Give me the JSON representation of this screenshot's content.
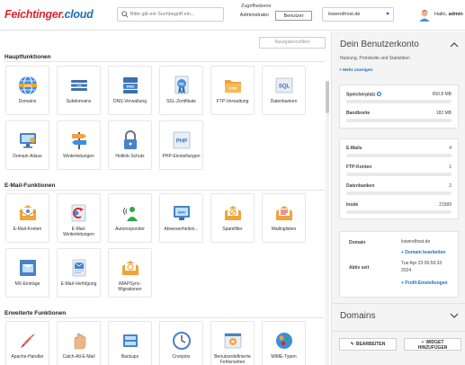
{
  "header": {
    "logo": {
      "part1": "Feichtinger",
      "dot": ".",
      "part2": "cloud"
    },
    "search_placeholder": "Bitte gib ein Suchbegriff ein...",
    "access_label": "Zugriffsebene",
    "access_admin": "Administrator",
    "access_user": "Benutzer",
    "domain": "lowendhost.de",
    "greeting": "Hallo,",
    "username": "admin"
  },
  "nav_filter": "Navigationsfilter",
  "sections": [
    {
      "title": "Hauptfunktionen",
      "tiles": [
        {
          "label": "Domains",
          "icon": "globe-icon"
        },
        {
          "label": "Subdomains",
          "icon": "subdomain-icon"
        },
        {
          "label": "DNS-Verwaltung",
          "icon": "dns-icon"
        },
        {
          "label": "SSL-Zertifikate",
          "icon": "ssl-certificate-icon"
        },
        {
          "label": "FTP-Verwaltung",
          "icon": "ftp-icon"
        },
        {
          "label": "Datenbanken",
          "icon": "sql-database-icon"
        },
        {
          "label": "Domain-Aliase",
          "icon": "monitor-icon"
        },
        {
          "label": "Weiterleitungen",
          "icon": "signpost-icon"
        },
        {
          "label": "Hotlink-Schutz",
          "icon": "lock-icon"
        },
        {
          "label": "PHP-Einstellungen",
          "icon": "php-icon"
        }
      ]
    },
    {
      "title": "E-Mail-Funktionen",
      "tiles": [
        {
          "label": "E-Mail-Konten",
          "icon": "email-account-icon"
        },
        {
          "label": "E-Mail-Weiterleitungen",
          "icon": "email-forward-icon"
        },
        {
          "label": "Autoresponder",
          "icon": "autoresponder-icon"
        },
        {
          "label": "Abwesenheitsn...",
          "icon": "away-message-icon"
        },
        {
          "label": "Spamfilter",
          "icon": "spam-filter-icon"
        },
        {
          "label": "Mailinglisten",
          "icon": "mailing-list-icon"
        },
        {
          "label": "MX-Einträge",
          "icon": "mx-record-icon"
        },
        {
          "label": "E-Mail-Verfolgung",
          "icon": "email-tracking-icon"
        },
        {
          "label": "IMAPSync-Migrationen",
          "icon": "imapsync-icon"
        }
      ]
    },
    {
      "title": "Erweiterte Funktionen",
      "tiles": [
        {
          "label": "Apache-Handler",
          "icon": "apache-feather-icon"
        },
        {
          "label": "Catch-All-E-Mail",
          "icon": "catch-all-hand-icon"
        },
        {
          "label": "Backups",
          "icon": "backup-icon"
        },
        {
          "label": "Cronjobs",
          "icon": "cronjob-icon"
        },
        {
          "label": "Benutzerdefinierte Fehlerseiten",
          "icon": "error-page-icon"
        },
        {
          "label": "MIME-Typen",
          "icon": "mime-types-icon"
        }
      ]
    }
  ],
  "sidebar": {
    "title": "Dein Benutzerkonto",
    "subtitle": "Nutzung, Protokolle und Statistiken",
    "more_link": "+ Mehr anzeigen",
    "usage": [
      {
        "label": "Speicherplatz",
        "value": "650.8 MB",
        "fraction": 0.0,
        "info": "i"
      },
      {
        "label": "Bandbreite",
        "value": "182 MB",
        "fraction": 0.0
      }
    ],
    "counts": [
      {
        "label": "E-Mails",
        "value": "4",
        "fraction": 0.0
      },
      {
        "label": "FTP-Konten",
        "value": "1",
        "fraction": 0.0
      },
      {
        "label": "Datenbanken",
        "value": "2",
        "fraction": 0.0
      },
      {
        "label": "Inode",
        "value": "21589",
        "fraction": 0.0
      }
    ],
    "details": {
      "domain_label": "Domain",
      "domain_value": "lowendhost.de",
      "edit_domain_link": "+ Domain bearbeiten",
      "active_since_label": "Aktiv seit",
      "active_since_value_1": "Tue Apr 23 06:59:33",
      "active_since_value_2": "2024",
      "profile_settings_link": "+ Profil-Einstellungen"
    },
    "domains_title": "Domains",
    "edit_button": "BEARBEITEN",
    "add_widget_button_1": "WIDGET",
    "add_widget_button_2": "HINZUFÜGEN"
  }
}
